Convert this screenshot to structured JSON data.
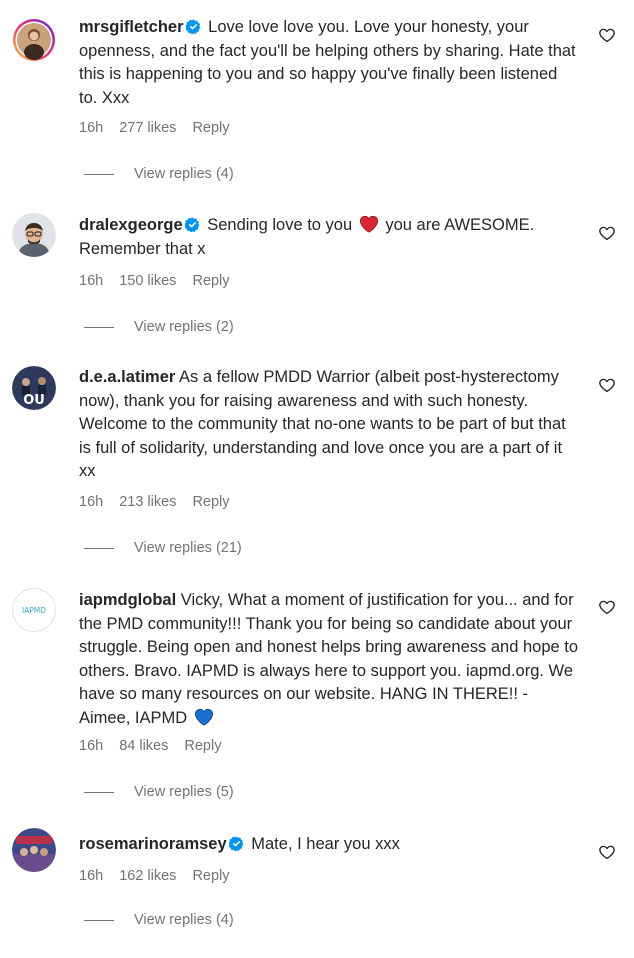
{
  "comments": [
    {
      "username": "mrsgifletcher",
      "verified": true,
      "text": "Love love love you. Love your honesty, your openness, and the fact you'll be helping others by sharing. Hate that this is happening to you and so happy you've finally been listened to. Xxx",
      "time": "16h",
      "likes": "277 likes",
      "reply": "Reply",
      "view_replies": "View replies (4)"
    },
    {
      "username": "dralexgeorge",
      "verified": true,
      "text_before": "Sending love to you",
      "emoji": "red-heart-emoji",
      "text_after": "you are AWESOME. Remember that x",
      "time": "16h",
      "likes": "150 likes",
      "reply": "Reply",
      "view_replies": "View replies (2)"
    },
    {
      "username": "d.e.a.latimer",
      "verified": false,
      "text": "As a fellow PMDD Warrior (albeit post-hysterectomy now), thank you for raising awareness and with such honesty. Welcome to the community that no-one wants to be part of but that is full of solidarity, understanding and love once you are a part of it xx",
      "time": "16h",
      "likes": "213 likes",
      "reply": "Reply",
      "view_replies": "View replies (21)"
    },
    {
      "username": "iapmdglobal",
      "verified": false,
      "avatar_text": "IAPMD",
      "text": "Vicky, What a moment of justification for you... and for the PMD community!!! Thank you for being so candidate about your struggle. Being open and honest helps bring awareness and hope to others. Bravo. IAPMD is always here to support you. iapmd.org. We have so many resources on our website. HANG IN THERE!! - Aimee, IAPMD",
      "emoji": "blue-heart-emoji",
      "time": "16h",
      "likes": "84 likes",
      "reply": "Reply",
      "view_replies": "View replies (5)"
    },
    {
      "username": "rosemarinoramsey",
      "verified": true,
      "text": "Mate, I hear you xxx",
      "time": "16h",
      "likes": "162 likes",
      "reply": "Reply",
      "view_replies": "View replies (4)"
    }
  ],
  "colors": {
    "text": "#262626",
    "secondary": "#737373",
    "verified_blue": "#0095f6",
    "heart_red": "#e0245e",
    "heart_blue": "#1d6fd6"
  }
}
